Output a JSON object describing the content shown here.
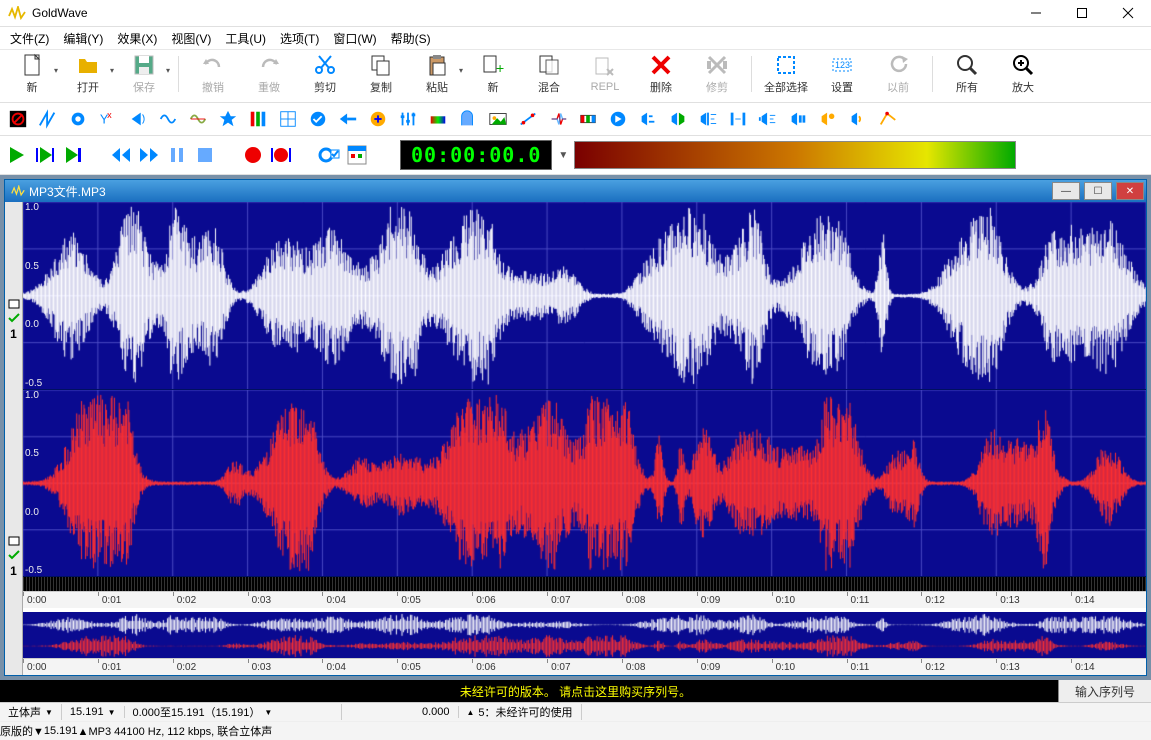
{
  "app_title": "GoldWave",
  "menubar": [
    "文件(Z)",
    "编辑(Y)",
    "效果(X)",
    "视图(V)",
    "工具(U)",
    "选项(T)",
    "窗口(W)",
    "帮助(S)"
  ],
  "toolbar1": [
    {
      "name": "new",
      "label": "新",
      "icon": "file",
      "dd": true
    },
    {
      "name": "open",
      "label": "打开",
      "icon": "folder",
      "dd": true
    },
    {
      "name": "save",
      "label": "保存",
      "icon": "disk",
      "dd": true,
      "disabled": true
    },
    {
      "sep": true
    },
    {
      "name": "undo",
      "label": "撤销",
      "icon": "undo",
      "disabled": true
    },
    {
      "name": "redo",
      "label": "重做",
      "icon": "redo",
      "disabled": true
    },
    {
      "name": "cut",
      "label": "剪切",
      "icon": "scissors"
    },
    {
      "name": "copy",
      "label": "复制",
      "icon": "copy"
    },
    {
      "name": "paste",
      "label": "粘贴",
      "icon": "paste",
      "dd": true
    },
    {
      "name": "new2",
      "label": "新",
      "icon": "copynew"
    },
    {
      "name": "mix",
      "label": "混合",
      "icon": "mix"
    },
    {
      "name": "repl",
      "label": "REPL",
      "icon": "repl",
      "disabled": true
    },
    {
      "name": "delete",
      "label": "删除",
      "icon": "x-red"
    },
    {
      "name": "trim",
      "label": "修剪",
      "icon": "trim",
      "disabled": true
    },
    {
      "sep": true
    },
    {
      "name": "selall",
      "label": "全部选择",
      "icon": "selall"
    },
    {
      "name": "set",
      "label": "设置",
      "icon": "set123"
    },
    {
      "name": "prev",
      "label": "以前",
      "icon": "prev",
      "disabled": true
    },
    {
      "sep": true
    },
    {
      "name": "all",
      "label": "所有",
      "icon": "zoom"
    },
    {
      "name": "zoomin",
      "label": "放大",
      "icon": "zoomin"
    }
  ],
  "doc_title": "MP3文件.MP3",
  "timecode": "00:00:00.0",
  "ylabels": [
    "1.0",
    "0.5",
    "0.0",
    "-0.5"
  ],
  "timeline_ticks": [
    "0:00",
    "0:01",
    "0:02",
    "0:03",
    "0:04",
    "0:05",
    "0:06",
    "0:07",
    "0:08",
    "0:09",
    "0:10",
    "0:11",
    "0:12",
    "0:13",
    "0:14"
  ],
  "license_text": "未经许可的版本。 请点击这里购买序列号。",
  "license_button": "输入序列号",
  "status1": {
    "channels": "立体声",
    "len": "15.191",
    "range": "0.000至15.191（15.191）",
    "pos": "0.000",
    "zoom": "5：未经许可的使用"
  },
  "status2": {
    "mode": "原版的",
    "len": "15.191",
    "format": "MP3 44100 Hz, 112 kbps, 联合立体声"
  },
  "chart_data": {
    "type": "waveform",
    "channels": 2,
    "duration_sec": 15.191,
    "sample_rate": 44100,
    "y_range": [
      -1.0,
      1.0
    ],
    "gridlines_y": [
      -0.5,
      0.0,
      0.5,
      1.0
    ],
    "x_ticks_sec": [
      0,
      1,
      2,
      3,
      4,
      5,
      6,
      7,
      8,
      9,
      10,
      11,
      12,
      13,
      14,
      15
    ],
    "selection_sec": [
      0.0,
      15.191
    ],
    "channel_colors": [
      "#ffffff",
      "#ff2020"
    ],
    "note": "amplitude envelope approximated; peaks near t≈6s reach ~0.9, typical speech bursts ~0.3–0.6, quiet gaps <0.05"
  }
}
